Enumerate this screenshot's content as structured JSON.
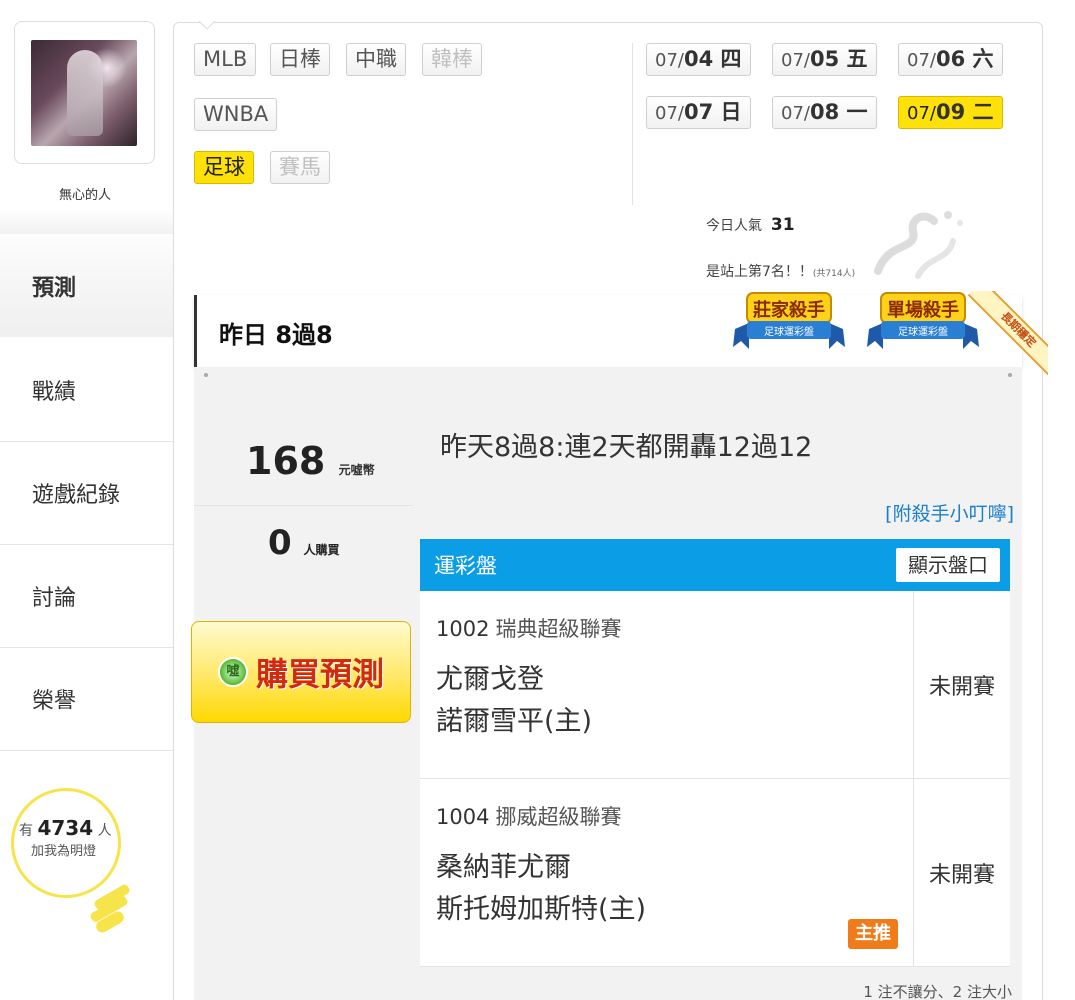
{
  "profile": {
    "username": "無心的人"
  },
  "nav": [
    {
      "label": "預測",
      "active": true
    },
    {
      "label": "戰績",
      "active": false
    },
    {
      "label": "遊戲紀錄",
      "active": false
    },
    {
      "label": "討論",
      "active": false
    },
    {
      "label": "榮譽",
      "active": false
    }
  ],
  "bulb": {
    "prefix": "有",
    "count": "4734",
    "suffix": "人",
    "label": "加我為明燈"
  },
  "sports": {
    "row1": [
      "MLB",
      "日棒",
      "中職",
      "韓棒"
    ],
    "row2": [
      "WNBA"
    ],
    "row3": [
      "足球",
      "賽馬"
    ],
    "disabled": [
      "韓棒",
      "賽馬"
    ],
    "selected": "足球"
  },
  "dates": [
    {
      "md": "07/",
      "day": "04 四"
    },
    {
      "md": "07/",
      "day": "05 五"
    },
    {
      "md": "07/",
      "day": "06 六"
    },
    {
      "md": "07/",
      "day": "07 日"
    },
    {
      "md": "07/",
      "day": "08 一"
    },
    {
      "md": "07/",
      "day": "09 二",
      "selected": true
    }
  ],
  "popularity": {
    "label": "今日人氣",
    "value": "31",
    "rank_text": "是站上第7名！！",
    "total": "(共714人)"
  },
  "yesterday": {
    "text": "昨日 8過8",
    "badges": [
      {
        "title": "莊家殺手",
        "sub": "足球運彩盤"
      },
      {
        "title": "單場殺手",
        "sub": "足球運彩盤"
      }
    ],
    "ribbon": "長期穩定"
  },
  "stats": {
    "price": "168",
    "price_unit": "元噓幣",
    "buyers": "0",
    "buyers_unit": "人購買"
  },
  "buy_button": {
    "icon_text": "噓",
    "label": "購買預測"
  },
  "headline": "昨天8過8:連2天都開轟12過12",
  "tip_link": "[附殺手小叮嚀]",
  "bet_table": {
    "title": "運彩盤",
    "show_button": "顯示盤口",
    "matches": [
      {
        "code": "1002",
        "league": "瑞典超級聯賽",
        "home_away": [
          "尤爾戈登",
          "諾爾雪平(主)"
        ],
        "status": "未開賽",
        "main_pick": ""
      },
      {
        "code": "1004",
        "league": "挪威超級聯賽",
        "home_away": [
          "桑納菲尤爾",
          "斯托姆加斯特(主)"
        ],
        "status": "未開賽",
        "main_pick": "主推"
      }
    ]
  },
  "footer_note": "1 注不讓分、2 注大小",
  "colors": {
    "accent_blue": "#0b9de6",
    "selected_yellow": "#ffe10a",
    "buy_red": "#d02b10",
    "link_blue": "#1a7fcf",
    "main_pick_orange": "#f07b1b"
  }
}
